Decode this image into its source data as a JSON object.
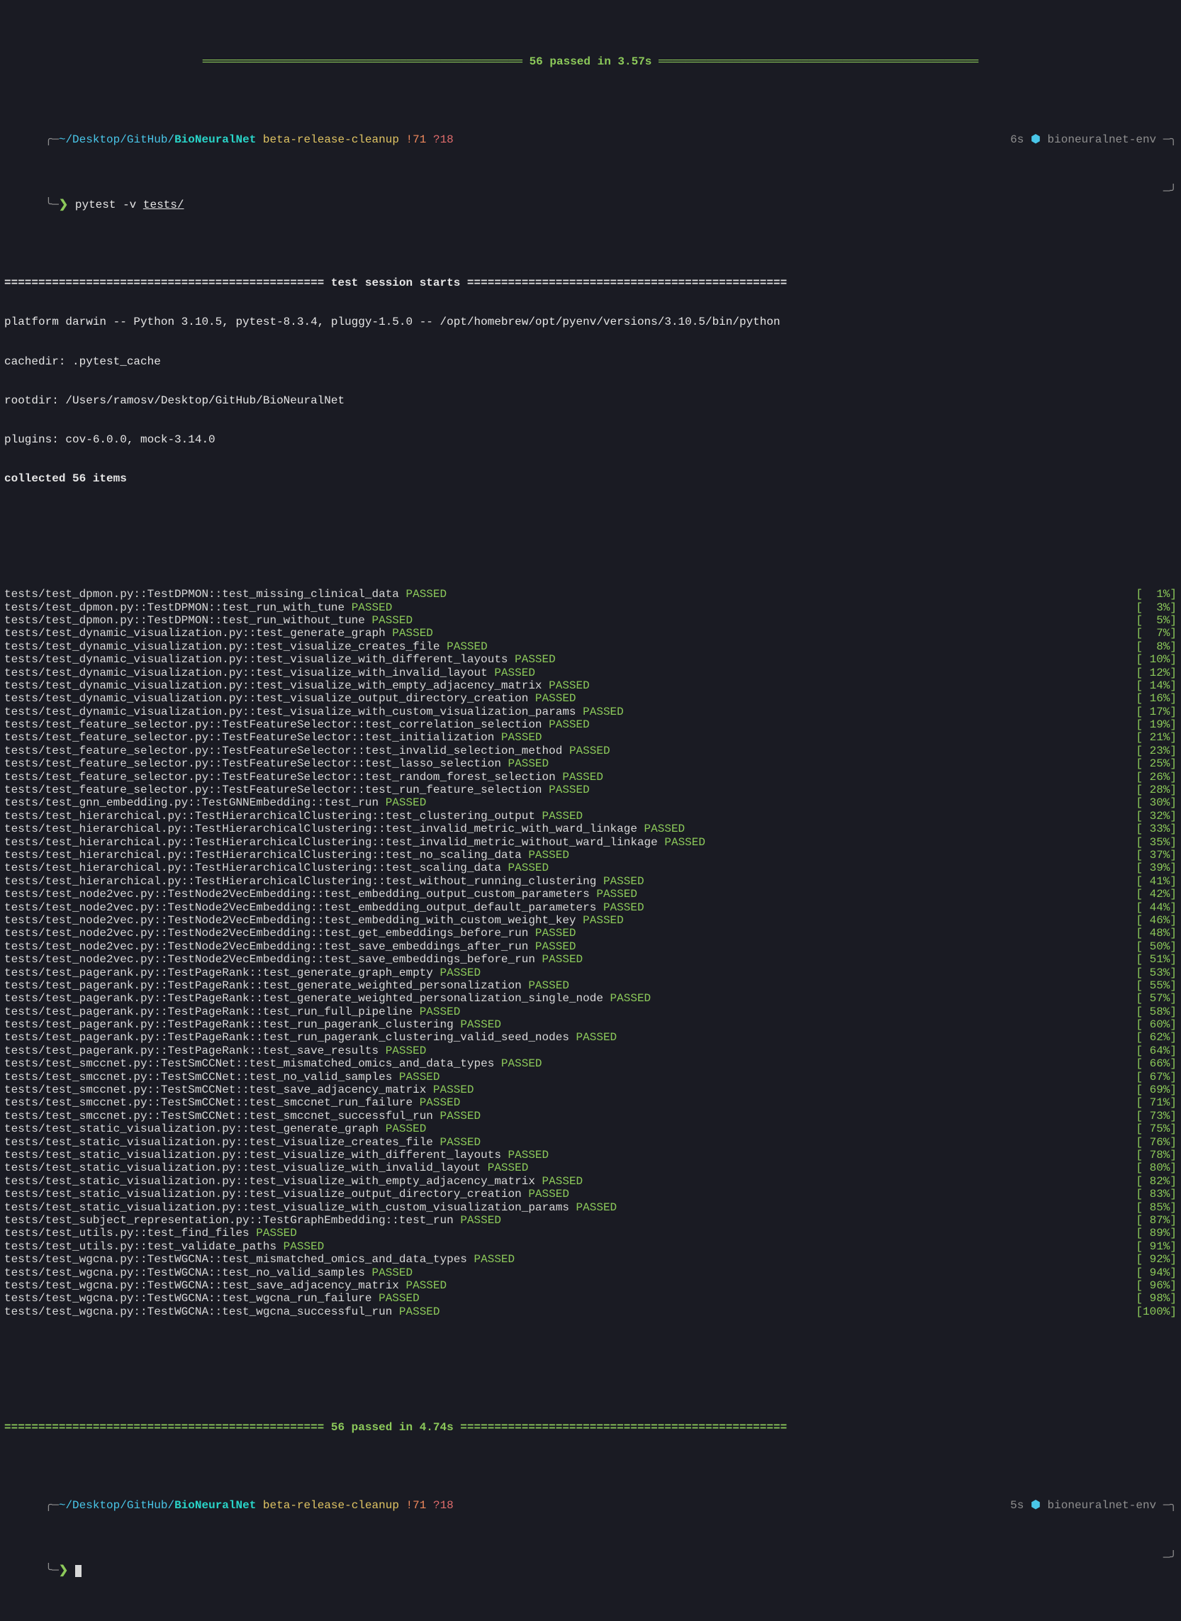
{
  "top_passed_line": "═══════════════════════════════════════════════ 56 passed in 3.57s ═══════════════════════════════════════════════",
  "prompt1": {
    "path_prefix": "~/Desktop/GitHub/",
    "repo": "BioNeuralNet",
    "branch": "beta-release-cleanup",
    "stash": "!71",
    "untracked": "?18",
    "time": "6s",
    "hex": "⬢",
    "env": "bioneuralnet-env",
    "arrow": "❯",
    "command": "pytest -v ",
    "command_arg": "tests/"
  },
  "session": {
    "sep_start": "=============================================== test session starts ===============================================",
    "platform": "platform darwin -- Python 3.10.5, pytest-8.3.4, pluggy-1.5.0 -- /opt/homebrew/opt/pyenv/versions/3.10.5/bin/python",
    "cachedir": "cachedir: .pytest_cache",
    "rootdir": "rootdir: /Users/ramosv/Desktop/GitHub/BioNeuralNet",
    "plugins": "plugins: cov-6.0.0, mock-3.14.0",
    "collected": "collected 56 items"
  },
  "tests": [
    {
      "name": "tests/test_dpmon.py::TestDPMON::test_missing_clinical_data",
      "status": "PASSED",
      "pct": "[  1%]"
    },
    {
      "name": "tests/test_dpmon.py::TestDPMON::test_run_with_tune",
      "status": "PASSED",
      "pct": "[  3%]"
    },
    {
      "name": "tests/test_dpmon.py::TestDPMON::test_run_without_tune",
      "status": "PASSED",
      "pct": "[  5%]"
    },
    {
      "name": "tests/test_dynamic_visualization.py::test_generate_graph",
      "status": "PASSED",
      "pct": "[  7%]"
    },
    {
      "name": "tests/test_dynamic_visualization.py::test_visualize_creates_file",
      "status": "PASSED",
      "pct": "[  8%]"
    },
    {
      "name": "tests/test_dynamic_visualization.py::test_visualize_with_different_layouts",
      "status": "PASSED",
      "pct": "[ 10%]"
    },
    {
      "name": "tests/test_dynamic_visualization.py::test_visualize_with_invalid_layout",
      "status": "PASSED",
      "pct": "[ 12%]"
    },
    {
      "name": "tests/test_dynamic_visualization.py::test_visualize_with_empty_adjacency_matrix",
      "status": "PASSED",
      "pct": "[ 14%]"
    },
    {
      "name": "tests/test_dynamic_visualization.py::test_visualize_output_directory_creation",
      "status": "PASSED",
      "pct": "[ 16%]"
    },
    {
      "name": "tests/test_dynamic_visualization.py::test_visualize_with_custom_visualization_params",
      "status": "PASSED",
      "pct": "[ 17%]"
    },
    {
      "name": "tests/test_feature_selector.py::TestFeatureSelector::test_correlation_selection",
      "status": "PASSED",
      "pct": "[ 19%]"
    },
    {
      "name": "tests/test_feature_selector.py::TestFeatureSelector::test_initialization",
      "status": "PASSED",
      "pct": "[ 21%]"
    },
    {
      "name": "tests/test_feature_selector.py::TestFeatureSelector::test_invalid_selection_method",
      "status": "PASSED",
      "pct": "[ 23%]"
    },
    {
      "name": "tests/test_feature_selector.py::TestFeatureSelector::test_lasso_selection",
      "status": "PASSED",
      "pct": "[ 25%]"
    },
    {
      "name": "tests/test_feature_selector.py::TestFeatureSelector::test_random_forest_selection",
      "status": "PASSED",
      "pct": "[ 26%]"
    },
    {
      "name": "tests/test_feature_selector.py::TestFeatureSelector::test_run_feature_selection",
      "status": "PASSED",
      "pct": "[ 28%]"
    },
    {
      "name": "tests/test_gnn_embedding.py::TestGNNEmbedding::test_run",
      "status": "PASSED",
      "pct": "[ 30%]"
    },
    {
      "name": "tests/test_hierarchical.py::TestHierarchicalClustering::test_clustering_output",
      "status": "PASSED",
      "pct": "[ 32%]"
    },
    {
      "name": "tests/test_hierarchical.py::TestHierarchicalClustering::test_invalid_metric_with_ward_linkage",
      "status": "PASSED",
      "pct": "[ 33%]"
    },
    {
      "name": "tests/test_hierarchical.py::TestHierarchicalClustering::test_invalid_metric_without_ward_linkage",
      "status": "PASSED",
      "pct": "[ 35%]"
    },
    {
      "name": "tests/test_hierarchical.py::TestHierarchicalClustering::test_no_scaling_data",
      "status": "PASSED",
      "pct": "[ 37%]"
    },
    {
      "name": "tests/test_hierarchical.py::TestHierarchicalClustering::test_scaling_data",
      "status": "PASSED",
      "pct": "[ 39%]"
    },
    {
      "name": "tests/test_hierarchical.py::TestHierarchicalClustering::test_without_running_clustering",
      "status": "PASSED",
      "pct": "[ 41%]"
    },
    {
      "name": "tests/test_node2vec.py::TestNode2VecEmbedding::test_embedding_output_custom_parameters",
      "status": "PASSED",
      "pct": "[ 42%]"
    },
    {
      "name": "tests/test_node2vec.py::TestNode2VecEmbedding::test_embedding_output_default_parameters",
      "status": "PASSED",
      "pct": "[ 44%]"
    },
    {
      "name": "tests/test_node2vec.py::TestNode2VecEmbedding::test_embedding_with_custom_weight_key",
      "status": "PASSED",
      "pct": "[ 46%]"
    },
    {
      "name": "tests/test_node2vec.py::TestNode2VecEmbedding::test_get_embeddings_before_run",
      "status": "PASSED",
      "pct": "[ 48%]"
    },
    {
      "name": "tests/test_node2vec.py::TestNode2VecEmbedding::test_save_embeddings_after_run",
      "status": "PASSED",
      "pct": "[ 50%]"
    },
    {
      "name": "tests/test_node2vec.py::TestNode2VecEmbedding::test_save_embeddings_before_run",
      "status": "PASSED",
      "pct": "[ 51%]"
    },
    {
      "name": "tests/test_pagerank.py::TestPageRank::test_generate_graph_empty",
      "status": "PASSED",
      "pct": "[ 53%]"
    },
    {
      "name": "tests/test_pagerank.py::TestPageRank::test_generate_weighted_personalization",
      "status": "PASSED",
      "pct": "[ 55%]"
    },
    {
      "name": "tests/test_pagerank.py::TestPageRank::test_generate_weighted_personalization_single_node",
      "status": "PASSED",
      "pct": "[ 57%]"
    },
    {
      "name": "tests/test_pagerank.py::TestPageRank::test_run_full_pipeline",
      "status": "PASSED",
      "pct": "[ 58%]"
    },
    {
      "name": "tests/test_pagerank.py::TestPageRank::test_run_pagerank_clustering",
      "status": "PASSED",
      "pct": "[ 60%]"
    },
    {
      "name": "tests/test_pagerank.py::TestPageRank::test_run_pagerank_clustering_valid_seed_nodes",
      "status": "PASSED",
      "pct": "[ 62%]"
    },
    {
      "name": "tests/test_pagerank.py::TestPageRank::test_save_results",
      "status": "PASSED",
      "pct": "[ 64%]"
    },
    {
      "name": "tests/test_smccnet.py::TestSmCCNet::test_mismatched_omics_and_data_types",
      "status": "PASSED",
      "pct": "[ 66%]"
    },
    {
      "name": "tests/test_smccnet.py::TestSmCCNet::test_no_valid_samples",
      "status": "PASSED",
      "pct": "[ 67%]"
    },
    {
      "name": "tests/test_smccnet.py::TestSmCCNet::test_save_adjacency_matrix",
      "status": "PASSED",
      "pct": "[ 69%]"
    },
    {
      "name": "tests/test_smccnet.py::TestSmCCNet::test_smccnet_run_failure",
      "status": "PASSED",
      "pct": "[ 71%]"
    },
    {
      "name": "tests/test_smccnet.py::TestSmCCNet::test_smccnet_successful_run",
      "status": "PASSED",
      "pct": "[ 73%]"
    },
    {
      "name": "tests/test_static_visualization.py::test_generate_graph",
      "status": "PASSED",
      "pct": "[ 75%]"
    },
    {
      "name": "tests/test_static_visualization.py::test_visualize_creates_file",
      "status": "PASSED",
      "pct": "[ 76%]"
    },
    {
      "name": "tests/test_static_visualization.py::test_visualize_with_different_layouts",
      "status": "PASSED",
      "pct": "[ 78%]"
    },
    {
      "name": "tests/test_static_visualization.py::test_visualize_with_invalid_layout",
      "status": "PASSED",
      "pct": "[ 80%]"
    },
    {
      "name": "tests/test_static_visualization.py::test_visualize_with_empty_adjacency_matrix",
      "status": "PASSED",
      "pct": "[ 82%]"
    },
    {
      "name": "tests/test_static_visualization.py::test_visualize_output_directory_creation",
      "status": "PASSED",
      "pct": "[ 83%]"
    },
    {
      "name": "tests/test_static_visualization.py::test_visualize_with_custom_visualization_params",
      "status": "PASSED",
      "pct": "[ 85%]"
    },
    {
      "name": "tests/test_subject_representation.py::TestGraphEmbedding::test_run",
      "status": "PASSED",
      "pct": "[ 87%]"
    },
    {
      "name": "tests/test_utils.py::test_find_files",
      "status": "PASSED",
      "pct": "[ 89%]"
    },
    {
      "name": "tests/test_utils.py::test_validate_paths",
      "status": "PASSED",
      "pct": "[ 91%]"
    },
    {
      "name": "tests/test_wgcna.py::TestWGCNA::test_mismatched_omics_and_data_types",
      "status": "PASSED",
      "pct": "[ 92%]"
    },
    {
      "name": "tests/test_wgcna.py::TestWGCNA::test_no_valid_samples",
      "status": "PASSED",
      "pct": "[ 94%]"
    },
    {
      "name": "tests/test_wgcna.py::TestWGCNA::test_save_adjacency_matrix",
      "status": "PASSED",
      "pct": "[ 96%]"
    },
    {
      "name": "tests/test_wgcna.py::TestWGCNA::test_wgcna_run_failure",
      "status": "PASSED",
      "pct": "[ 98%]"
    },
    {
      "name": "tests/test_wgcna.py::TestWGCNA::test_wgcna_successful_run",
      "status": "PASSED",
      "pct": "[100%]"
    }
  ],
  "summary_line": "=============================================== 56 passed in 4.74s ================================================",
  "prompt2": {
    "path_prefix": "~/Desktop/GitHub/",
    "repo": "BioNeuralNet",
    "branch": "beta-release-cleanup",
    "stash": "!71",
    "untracked": "?18",
    "time": "5s",
    "hex": "⬢",
    "env": "bioneuralnet-env",
    "arrow": "❯"
  }
}
